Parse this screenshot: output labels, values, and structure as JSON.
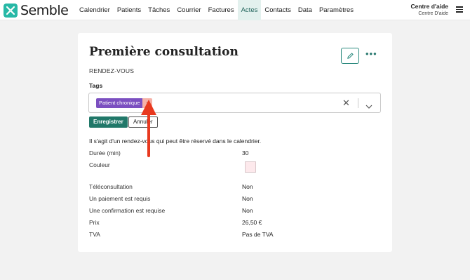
{
  "brand": {
    "name": "Semble",
    "accent": "#27b8a6"
  },
  "nav": {
    "items": [
      {
        "label": "Calendrier"
      },
      {
        "label": "Patients"
      },
      {
        "label": "Tâches"
      },
      {
        "label": "Courrier"
      },
      {
        "label": "Factures"
      },
      {
        "label": "Actes"
      },
      {
        "label": "Contacts"
      },
      {
        "label": "Data"
      },
      {
        "label": "Paramètres"
      }
    ],
    "active": "Actes"
  },
  "help": {
    "title": "Centre d'aide",
    "subtitle": "Centre D'aide"
  },
  "card": {
    "title": "Première consultation",
    "subtype": "RENDEZ-VOUS",
    "tags_label": "Tags",
    "tags": [
      {
        "label": "Patient chronique",
        "remove": "x",
        "color": "#7b4fc0"
      }
    ],
    "save_label": "Enregistrer",
    "cancel_label": "Annuler",
    "description": "Il s'agit d'un rendez-vous qui peut être réservé dans le calendrier.",
    "details": [
      {
        "label": "Durée (min)",
        "value": "30"
      },
      {
        "label": "Couleur",
        "value": "",
        "swatch": "#fde9ec"
      },
      {
        "label": "Téléconsultation",
        "value": "Non"
      },
      {
        "label": "Un paiement est requis",
        "value": "Non"
      },
      {
        "label": "Une confirmation est requise",
        "value": "Non"
      },
      {
        "label": "Prix",
        "value": "26,50 €"
      },
      {
        "label": "TVA",
        "value": "Pas de TVA"
      }
    ]
  },
  "annotation": {
    "icon": "red-arrow-icon",
    "color": "#e8391f"
  }
}
